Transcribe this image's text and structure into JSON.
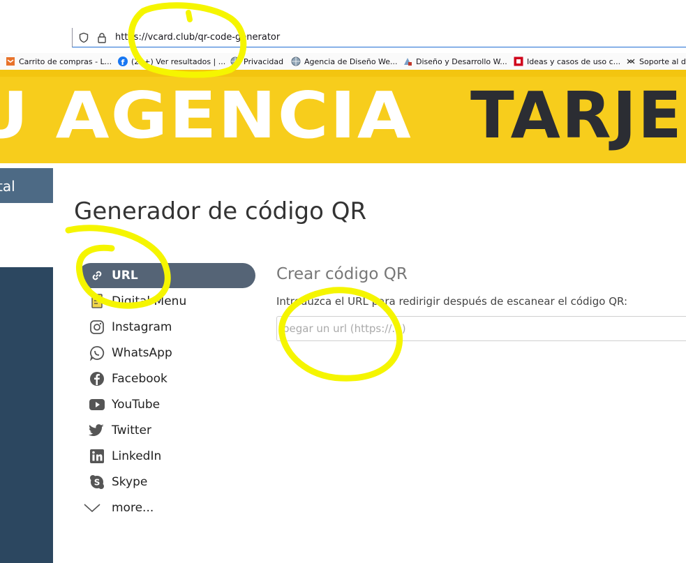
{
  "browser": {
    "url": "https://vcard.club/qr-code-generator",
    "bookmarks": [
      {
        "label": "Carrito de compras - L...",
        "icon": "shop-icon",
        "color": "#e8732b"
      },
      {
        "label": "(20+) Ver resultados | ...",
        "icon": "facebook-icon",
        "color": "#1877f2"
      },
      {
        "label": "Privacidad",
        "icon": "globe-icon",
        "color": "#5a6a7a"
      },
      {
        "label": "Agencia de Diseño We...",
        "icon": "globe-icon",
        "color": "#5a6a7a"
      },
      {
        "label": "Diseño y Desarrollo W...",
        "icon": "site-icon",
        "color": "#7a7a7a"
      },
      {
        "label": "Ideas y casos de uso c...",
        "icon": "red-square-icon",
        "color": "#d0021b"
      },
      {
        "label": "Soporte al di",
        "icon": "bug-icon",
        "color": "#333333"
      }
    ]
  },
  "banner": {
    "text_light": "U AGENCIA",
    "text_dark": "TARJE",
    "bg_color": "#f7cd1c"
  },
  "sidebar": {
    "label": "tal"
  },
  "main": {
    "title": "Generador de código QR",
    "menu": [
      {
        "label": "URL",
        "icon": "link-icon",
        "active": true
      },
      {
        "label": "Digital Menu",
        "icon": "menu-card-icon",
        "active": false
      },
      {
        "label": "Instagram",
        "icon": "instagram-icon",
        "active": false
      },
      {
        "label": "WhatsApp",
        "icon": "whatsapp-icon",
        "active": false
      },
      {
        "label": "Facebook",
        "icon": "facebook-icon",
        "active": false
      },
      {
        "label": "YouTube",
        "icon": "youtube-icon",
        "active": false
      },
      {
        "label": "Twitter",
        "icon": "twitter-icon",
        "active": false
      },
      {
        "label": "LinkedIn",
        "icon": "linkedin-icon",
        "active": false
      },
      {
        "label": "Skype",
        "icon": "skype-icon",
        "active": false
      },
      {
        "label": "more...",
        "icon": "chevron-down-icon",
        "active": false
      }
    ],
    "section_title": "Crear código QR",
    "section_desc": "Introduzca el URL para redirigir después de escanear el código QR:",
    "input": {
      "value": "",
      "placeholder": "pegar un url (https://...)"
    }
  },
  "colors": {
    "active_menu_bg": "#556476",
    "annotation": "#f5f500"
  }
}
